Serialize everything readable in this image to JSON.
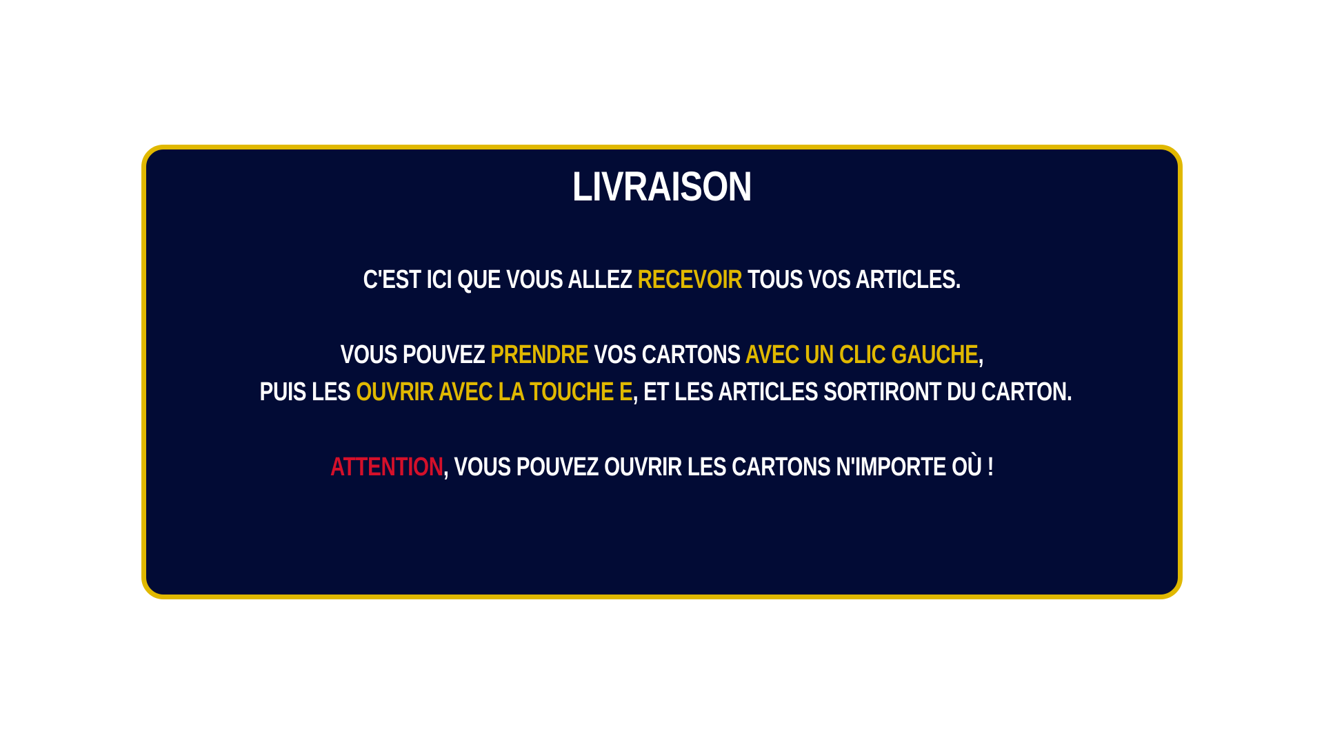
{
  "colors": {
    "background": "#ffffff",
    "panel": "#020b35",
    "border": "#e0b800",
    "text": "#ffffff",
    "highlight": "#e0b800",
    "warning": "#d4102a"
  },
  "panel": {
    "title": "LIVRAISON",
    "line1": {
      "a": "C'EST ICI QUE VOUS ALLEZ ",
      "b": "RECEVOIR",
      "c": " TOUS VOS ARTICLES."
    },
    "line2": {
      "a": "VOUS POUVEZ ",
      "b": "PRENDRE",
      "c": " VOS CARTONS ",
      "d": "AVEC UN CLIC GAUCHE",
      "e": ","
    },
    "line3": {
      "a": "PUIS LES ",
      "b": "OUVRIR AVEC LA TOUCHE E",
      "c": ", ET LES ARTICLES SORTIRONT DU CARTON."
    },
    "line4": {
      "a": "ATTENTION",
      "b": ", VOUS POUVEZ OUVRIR LES CARTONS N'IMPORTE OÙ !"
    }
  }
}
